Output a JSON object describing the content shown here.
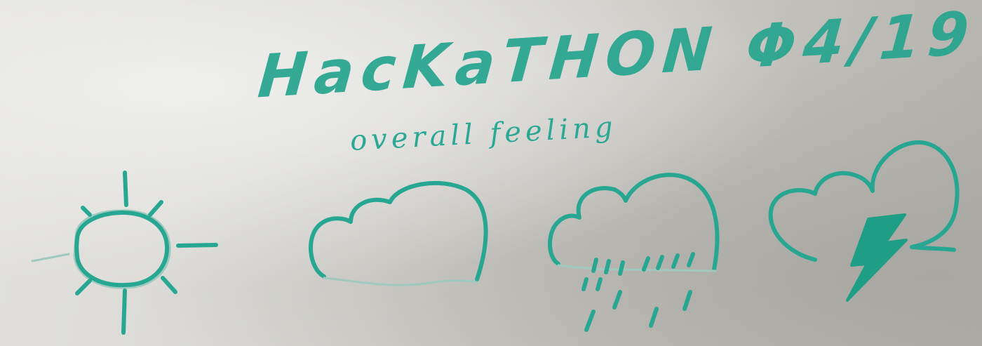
{
  "whiteboard": {
    "title": "HacKaTHON Φ4/19",
    "subtitle": "overall feeling",
    "icons": [
      "sun-icon",
      "cloud-icon",
      "rain-cloud-icon",
      "thunderstorm-icon"
    ],
    "ink_color": "#27a792",
    "board_color": "#d6d5d1"
  }
}
